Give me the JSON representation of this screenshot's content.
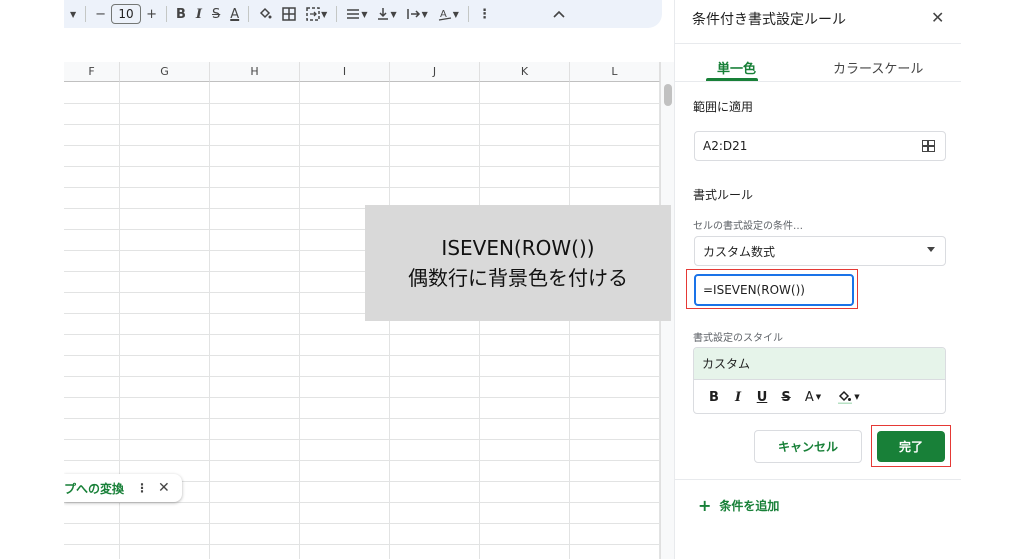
{
  "toolbar": {
    "font_size": "10",
    "minus": "−",
    "plus": "+",
    "bold": "B",
    "italic": "I",
    "strike": "S",
    "text_color": "A"
  },
  "columns": [
    "F",
    "G",
    "H",
    "I",
    "J",
    "K",
    "L"
  ],
  "chip": {
    "label": "プへの変換",
    "more": "⋮",
    "close": "✕"
  },
  "overlay": {
    "line1": "ISEVEN(ROW())",
    "line2": "偶数行に背景色を付ける"
  },
  "panel": {
    "title": "条件付き書式設定ルール",
    "close": "✕",
    "tabs": [
      {
        "label": "単一色",
        "active": true
      },
      {
        "label": "カラースケール",
        "active": false
      }
    ],
    "apply_range_label": "範囲に適用",
    "apply_range_value": "A2:D21",
    "format_rules_label": "書式ルール",
    "condition_label": "セルの書式設定の条件…",
    "condition_value": "カスタム数式",
    "formula_value": "=ISEVEN(ROW())",
    "style_label": "書式設定のスタイル",
    "style_preview": "カスタム",
    "style_tools": {
      "bold": "B",
      "italic": "I",
      "underline": "U",
      "strike": "S",
      "text_color": "A",
      "fill": "◈"
    },
    "cancel_label": "キャンセル",
    "done_label": "完了",
    "add_rule_label": "条件を追加",
    "add_rule_icon": "+",
    "accent_color": "#188038",
    "preview_bg": "#e6f4ea",
    "focus_color": "#1a73e8",
    "callout_color": "#e53935"
  }
}
